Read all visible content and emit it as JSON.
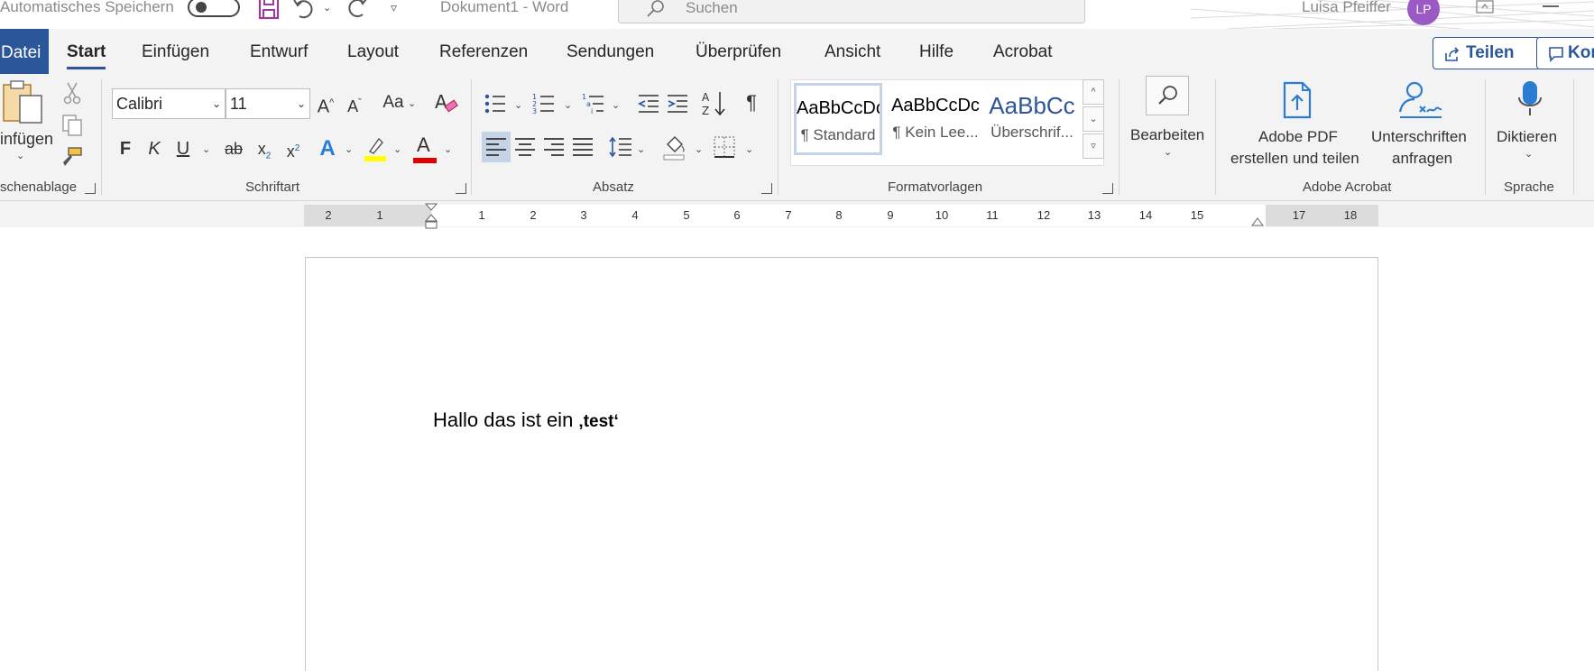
{
  "titlebar": {
    "autosave_label": "Automatisches Speichern",
    "document_title": "Dokument1  -  Word",
    "search_placeholder": "Suchen",
    "user_name": "Luisa Pfeiffer",
    "user_initials": "LP"
  },
  "tabs": {
    "file": "Datei",
    "items": [
      "Start",
      "Einfügen",
      "Entwurf",
      "Layout",
      "Referenzen",
      "Sendungen",
      "Überprüfen",
      "Ansicht",
      "Hilfe",
      "Acrobat"
    ],
    "active": "Start",
    "share_label": "Teilen",
    "comments_label": "Kor"
  },
  "clipboard": {
    "paste_label": "infügen",
    "group_label": "schenablage"
  },
  "font": {
    "font_name": "Calibri",
    "font_size": "11",
    "case_label": "Aa",
    "bold": "F",
    "italic": "K",
    "underline": "U",
    "strike": "ab",
    "subscript": "x",
    "superscript": "x",
    "text_effects": "A",
    "font_color": "A",
    "group_label": "Schriftart"
  },
  "paragraph": {
    "group_label": "Absatz",
    "pilcrow": "¶",
    "sort": "A Z"
  },
  "styles": {
    "items": [
      {
        "sample": "AaBbCcDc",
        "name": "¶ Standard"
      },
      {
        "sample": "AaBbCcDc",
        "name": "¶ Kein Lee..."
      },
      {
        "sample": "AaBbCc",
        "name": "Überschrif..."
      }
    ],
    "group_label": "Formatvorlagen"
  },
  "editing": {
    "label": "Bearbeiten"
  },
  "acrobat": {
    "create_pdf_line1": "Adobe PDF",
    "create_pdf_line2": "erstellen und teilen",
    "signatures_line1": "Unterschriften",
    "signatures_line2": "anfragen",
    "group_label": "Adobe Acrobat"
  },
  "voice": {
    "dictate_label": "Diktieren",
    "group_label": "Sprache"
  },
  "ruler": {
    "labels": [
      "2",
      "1",
      "1",
      "2",
      "3",
      "4",
      "5",
      "6",
      "7",
      "8",
      "9",
      "10",
      "11",
      "12",
      "13",
      "14",
      "15",
      "17",
      "18"
    ]
  },
  "document": {
    "body_text": "Hallo das ist ein ",
    "quoted_text": "‚test‘"
  },
  "colors": {
    "accent": "#2b579a",
    "highlight": "#ffff00",
    "font_color": "#e00000",
    "avatar": "#9b59c5"
  }
}
